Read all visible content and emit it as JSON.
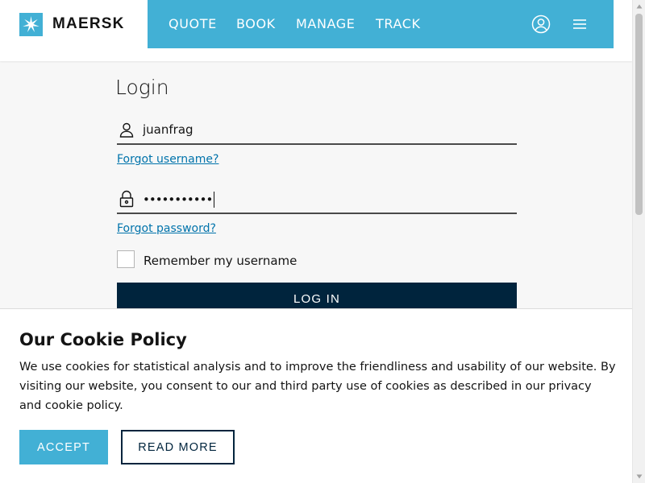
{
  "header": {
    "logo_text": "MAERSK",
    "nav": [
      {
        "label": "QUOTE"
      },
      {
        "label": "BOOK"
      },
      {
        "label": "MANAGE"
      },
      {
        "label": "TRACK"
      }
    ],
    "icons": [
      "user-icon",
      "menu-icon"
    ]
  },
  "login": {
    "title": "Login",
    "username_value": "juanfrag",
    "password_masked": "•••••••••••",
    "forgot_username": "Forgot username?",
    "forgot_password": "Forgot password?",
    "remember_label": "Remember my username",
    "remember_checked": false,
    "login_button": "LOG IN"
  },
  "cookie": {
    "title": "Our Cookie Policy",
    "text": "We use cookies for statistical analysis and to improve the friendliness and usability of our website. By visiting our website, you consent to our and third party use of cookies as described in our privacy and cookie policy.",
    "accept_button": "ACCEPT",
    "read_more_button": "READ MORE"
  },
  "colors": {
    "brand": "#42b0d5",
    "dark": "#00243d",
    "link": "#0073ab",
    "background": "#f7f7f7"
  }
}
